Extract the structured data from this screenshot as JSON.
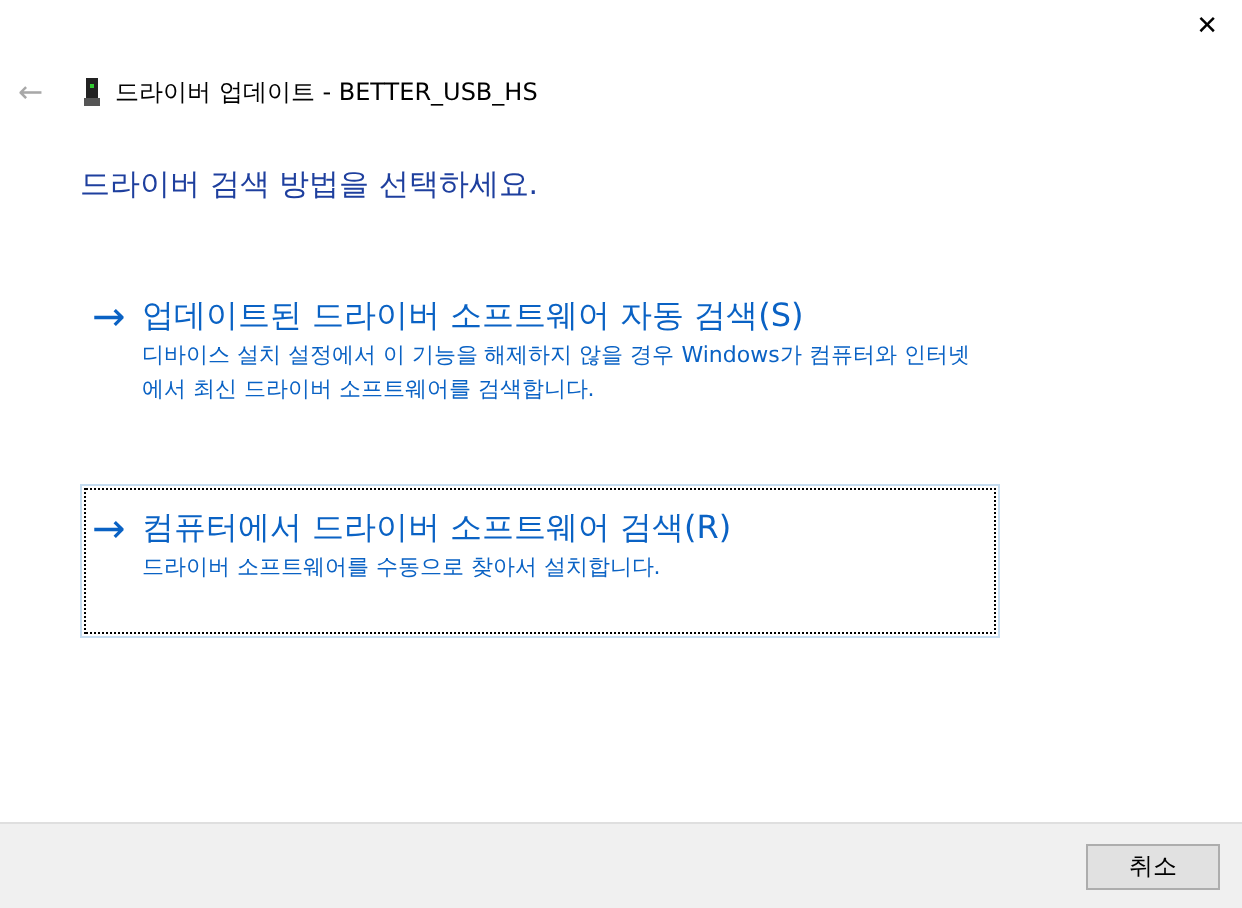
{
  "window": {
    "title": "드라이버 업데이트 - BETTER_USB_HS",
    "close": "✕",
    "back": "←"
  },
  "heading": "드라이버 검색 방법을 선택하세요.",
  "options": [
    {
      "arrow": "→",
      "title": "업데이트된 드라이버 소프트웨어 자동 검색(S)",
      "description": "디바이스 설치 설정에서 이 기능을 해제하지 않을 경우 Windows가 컴퓨터와 인터넷에서 최신 드라이버 소프트웨어를 검색합니다.",
      "selected": false
    },
    {
      "arrow": "→",
      "title": "컴퓨터에서 드라이버 소프트웨어 검색(R)",
      "description": "드라이버 소프트웨어를 수동으로 찾아서 설치합니다.",
      "selected": true
    }
  ],
  "buttons": [
    "취소"
  ]
}
